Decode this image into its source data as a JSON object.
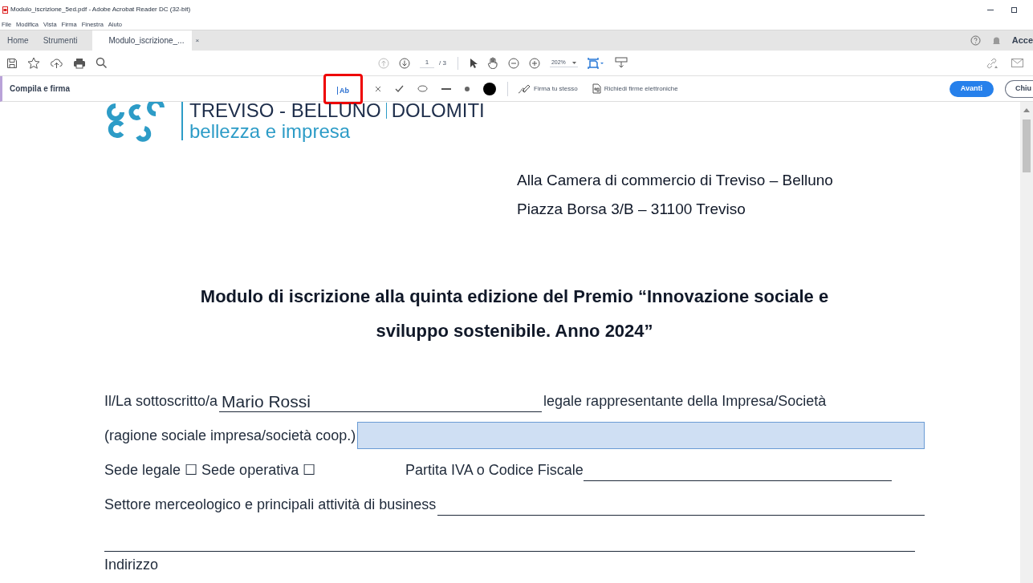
{
  "window": {
    "title": "Modulo_iscrizione_5ed.pdf - Adobe Acrobat Reader DC (32-bit)"
  },
  "menu": [
    "File",
    "Modifica",
    "Vista",
    "Firma",
    "Finestra",
    "Aiuto"
  ],
  "tabs": [
    {
      "label": "Home",
      "selected": false
    },
    {
      "label": "Strumenti",
      "selected": false
    },
    {
      "label": "Modulo_iscrizione_...",
      "selected": true,
      "close": "×"
    }
  ],
  "account": "Acce",
  "toolbar": {
    "page": "1",
    "total": "/ 3",
    "zoom": "202%"
  },
  "fill_sign": {
    "title": "Compila e firma",
    "tools": [
      {
        "kind": "text",
        "label": "Ab",
        "selected": true
      },
      {
        "kind": "cross",
        "selected": false
      },
      {
        "kind": "check",
        "selected": false
      },
      {
        "kind": "circle",
        "selected": false
      },
      {
        "kind": "line",
        "selected": false
      },
      {
        "kind": "dot",
        "selected": false
      },
      {
        "kind": "bigdot",
        "selected": false
      }
    ],
    "sign_self": "Firma tu stesso",
    "request": "Richiedi firme elettroniche",
    "next": "Avanti",
    "close": "Chiu"
  },
  "document": {
    "logo": {
      "line1": "TREVISO - BELLUNO",
      "line1b": "DOLOMITI",
      "line2": "bellezza e impresa"
    },
    "address": [
      "Alla Camera di commercio di Treviso – Belluno",
      "Piazza Borsa 3/B – 31100 Treviso"
    ],
    "title": [
      "Modulo di iscrizione alla quinta edizione del Premio “Innovazione sociale e",
      "sviluppo sostenibile. Anno 2024”"
    ],
    "rows": [
      {
        "kind": "field",
        "label": "Il/La sottoscritto/a",
        "value": "Mario Rossi",
        "after": "legale rappresentante della Impresa/Società"
      },
      {
        "kind": "field",
        "label": "(ragione sociale impresa/società coop.)",
        "focused": true
      },
      {
        "kind": "split",
        "left": "Sede legale ☐ Sede operativa ☐",
        "label": "Partita IVA o Codice Fiscale"
      },
      {
        "kind": "field",
        "label": "Settore merceologico e principali attività di business"
      },
      {
        "kind": "blank"
      },
      {
        "kind": "text",
        "label": "Indirizzo"
      }
    ]
  }
}
